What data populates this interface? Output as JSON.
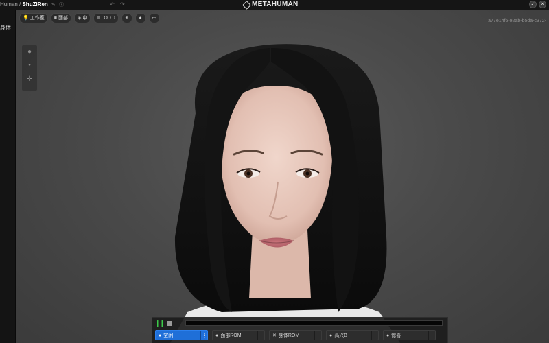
{
  "topbar": {
    "breadcrumb_prev": "Human /",
    "breadcrumb_current": "ShuZiRen",
    "edit_icon": "pencil-icon",
    "info_icon": "info-icon",
    "undo_icon": "undo-icon",
    "redo_icon": "redo-icon",
    "logo_text": "METAHUMAN",
    "right_icons": [
      "check-icon",
      "close-icon"
    ]
  },
  "sidebar": {
    "label": "身体"
  },
  "viewport": {
    "toolbar": {
      "studio": "工作室",
      "face": "面部",
      "quality": "中",
      "lod": "LOD 0",
      "icon_1": "link-icon",
      "icon_2": "sphere-icon",
      "icon_3": "camera-icon"
    },
    "asset_id": "a77e14f6-92ab-b5da-c372-"
  },
  "timeline": {
    "progress": 0.0,
    "presets": [
      {
        "label": "空闲",
        "icon": "idle-icon",
        "active": true
      },
      {
        "label": "面部ROM",
        "icon": "face-rom-icon",
        "active": false
      },
      {
        "label": "身体ROM",
        "icon": "body-rom-icon",
        "active": false
      },
      {
        "label": "高兴B",
        "icon": "happy-icon",
        "active": false
      },
      {
        "label": "惊喜",
        "icon": "surprise-icon",
        "active": false
      }
    ]
  },
  "colors": {
    "accent": "#1f6fd8",
    "play": "#3ccc4a",
    "viewport_bg": "#4a4a4a"
  }
}
